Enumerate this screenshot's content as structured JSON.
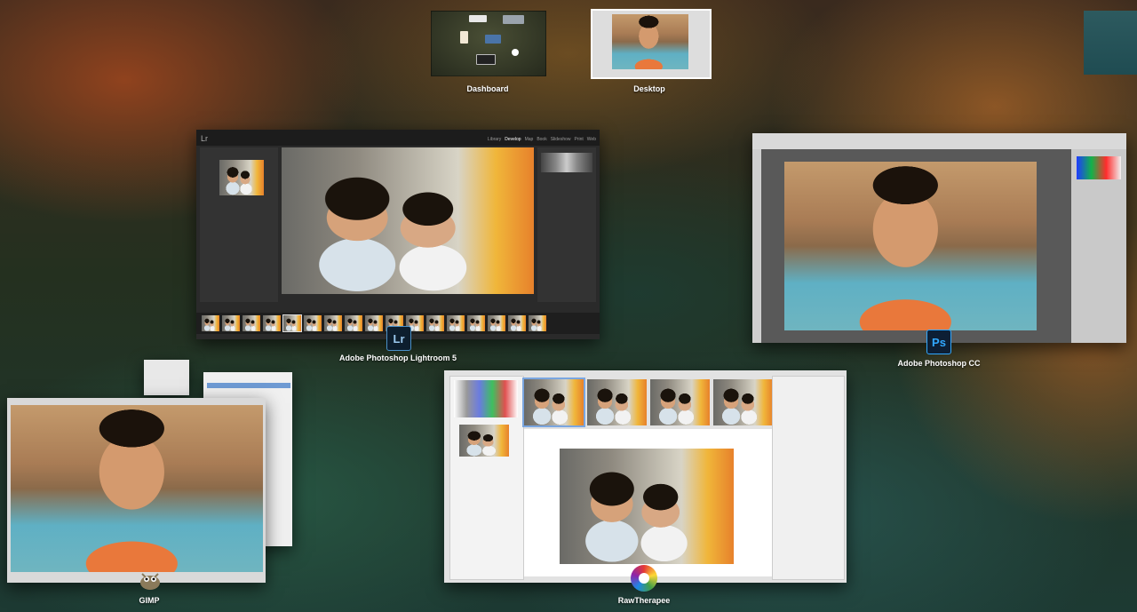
{
  "spaces": {
    "dashboard_label": "Dashboard",
    "desktop_label": "Desktop"
  },
  "windows": {
    "lightroom": {
      "label": "Adobe Photoshop Lightroom 5",
      "icon_text": "Lr",
      "logo": "Lr",
      "modules": [
        "Library",
        "Develop",
        "Map",
        "Book",
        "Slideshow",
        "Print",
        "Web"
      ],
      "active_module": "Develop"
    },
    "photoshop": {
      "label": "Adobe Photoshop CC",
      "icon_text": "Ps"
    },
    "gimp": {
      "label": "GIMP"
    },
    "rawtherapee": {
      "label": "RawTherapee"
    }
  },
  "colors": {
    "ps_accent": "#31a8ff",
    "lr_accent": "#9bc9ef"
  },
  "icons": {
    "lightroom": "lightroom-app-icon",
    "photoshop": "photoshop-app-icon",
    "gimp": "gimp-wilber-icon",
    "rawtherapee": "rawtherapee-aperture-icon"
  }
}
